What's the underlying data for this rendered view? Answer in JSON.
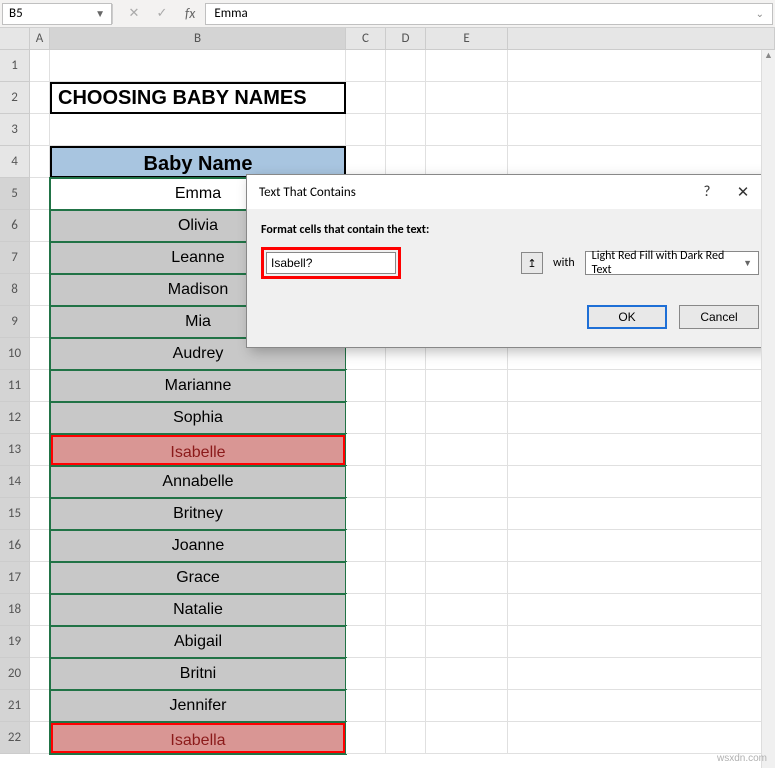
{
  "namebox": {
    "value": "B5"
  },
  "formula": {
    "value": "Emma"
  },
  "column_letters": [
    "A",
    "B",
    "C",
    "D",
    "E"
  ],
  "title": "CHOOSING BABY NAMES",
  "header": "Baby Name",
  "names": [
    "Emma",
    "Olivia",
    "Leanne",
    "Madison",
    "Mia",
    "Audrey",
    "Marianne",
    "Sophia",
    "Isabelle",
    "Annabelle",
    "Britney",
    "Joanne",
    "Grace",
    "Natalie",
    "Abigail",
    "Britni",
    "Jennifer",
    "Isabella"
  ],
  "matches": [
    "Isabelle",
    "Isabella"
  ],
  "dialog": {
    "title": "Text That Contains",
    "label": "Format cells that contain the text:",
    "input": "Isabell?",
    "with": "with",
    "format_option": "Light Red Fill with Dark Red Text",
    "ok": "OK",
    "cancel": "Cancel",
    "help": "?",
    "close": "✕"
  },
  "watermark": "wsxdn.com"
}
